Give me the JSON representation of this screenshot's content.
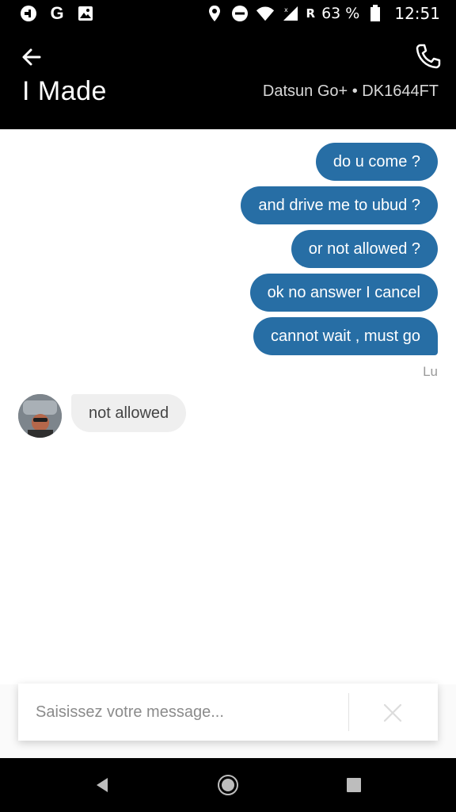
{
  "status_bar": {
    "left_icons": [
      "uber-icon",
      "google-icon",
      "image-icon"
    ],
    "google_letter": "G",
    "roaming": "R",
    "battery": "63 %",
    "time": "12:51"
  },
  "header": {
    "title": "I Made",
    "vehicle": "Datsun Go+ • DK1644FT"
  },
  "messages": {
    "outgoing": [
      "do u come ?",
      "and drive me to ubud ?",
      "or not allowed ?",
      "ok no answer I cancel",
      "cannot wait , must go"
    ],
    "sender_label": "Lu",
    "incoming": [
      "not allowed"
    ]
  },
  "composer": {
    "placeholder": "Saisissez votre message..."
  },
  "colors": {
    "bubble_out": "#276ea5",
    "bubble_in": "#efefef",
    "header_bg": "#000000"
  }
}
